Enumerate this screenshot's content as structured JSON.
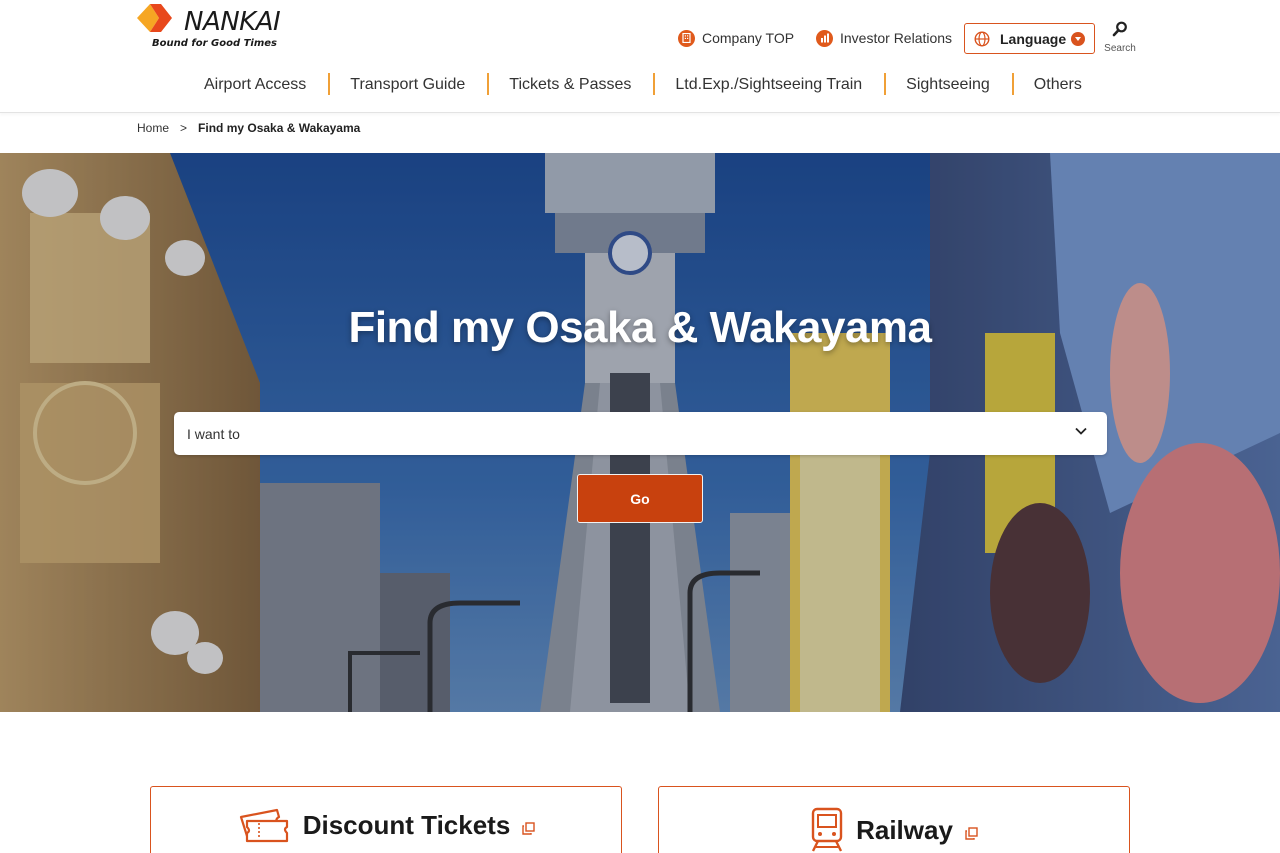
{
  "brand": {
    "name": "NANKAI",
    "tagline": "Bound for Good Times",
    "accent_color": "#d9531e",
    "logo_orange": "#e8481c",
    "logo_yellow": "#f6a623"
  },
  "utility": {
    "company_top": "Company TOP",
    "investor_relations": "Investor Relations",
    "language": "Language",
    "search": "Search"
  },
  "nav": {
    "items": [
      {
        "label": "Airport Access"
      },
      {
        "label": "Transport Guide"
      },
      {
        "label": "Tickets & Passes"
      },
      {
        "label": "Ltd.Exp./Sightseeing Train"
      },
      {
        "label": "Sightseeing"
      },
      {
        "label": "Others"
      }
    ]
  },
  "breadcrumb": {
    "home": "Home",
    "separator": ">",
    "current": "Find my Osaka & Wakayama"
  },
  "hero": {
    "title": "Find my Osaka & Wakayama",
    "select_value": "I want to",
    "go_label": "Go"
  },
  "cards": [
    {
      "title": "Discount Tickets",
      "icon": "ticket-icon"
    },
    {
      "title": "Railway",
      "icon": "train-icon"
    }
  ]
}
